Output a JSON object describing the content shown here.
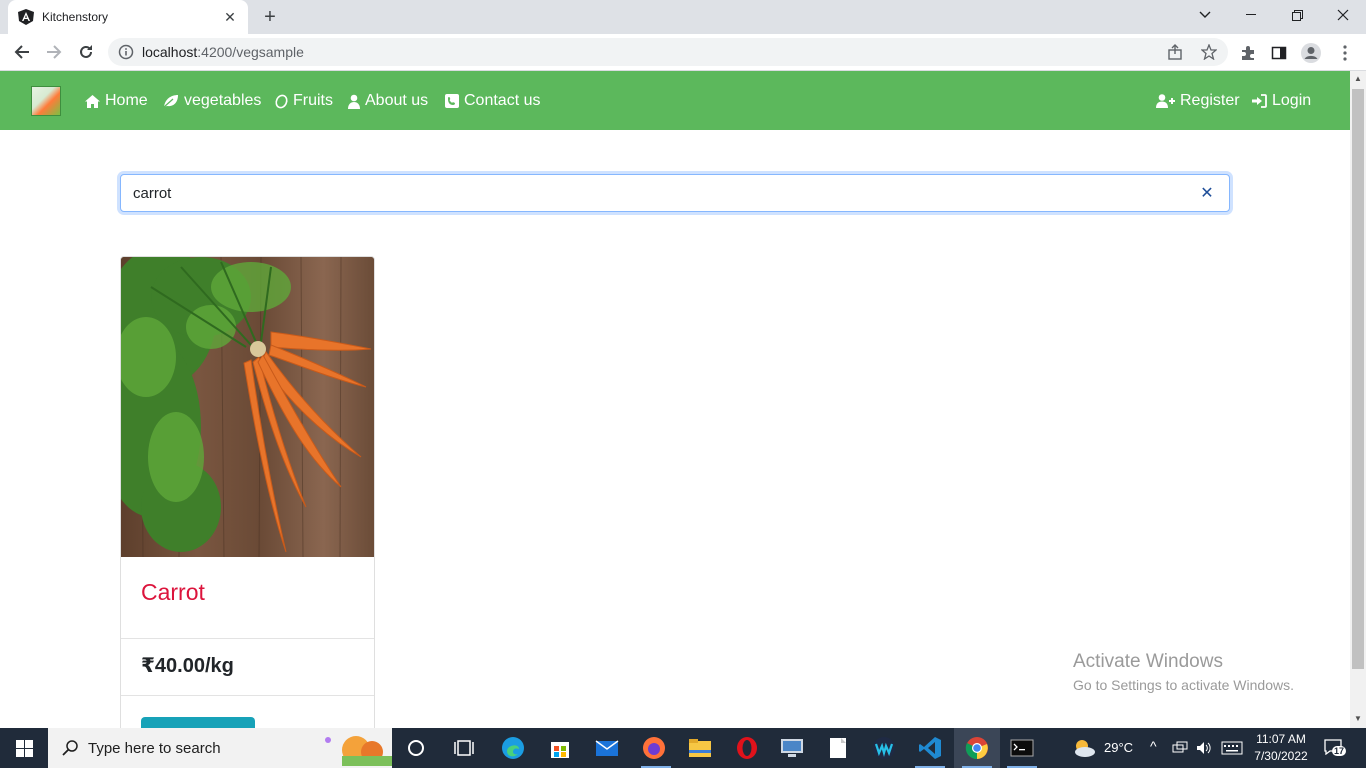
{
  "browser": {
    "tab_title": "Kitchenstory",
    "url_host": "localhost",
    "url_path": ":4200/vegsample"
  },
  "navbar": {
    "items": [
      {
        "label": "Home",
        "icon": "home-icon"
      },
      {
        "label": "vegetables",
        "icon": "leaf-icon"
      },
      {
        "label": "Fruits",
        "icon": "lemon-icon"
      },
      {
        "label": "About us",
        "icon": "user-icon"
      },
      {
        "label": "Contact us",
        "icon": "phone-icon"
      }
    ],
    "register_label": "Register",
    "login_label": "Login",
    "color": "#5cb85c"
  },
  "search": {
    "value": "carrot"
  },
  "products": [
    {
      "name": "Carrot",
      "price": "₹40.00/kg",
      "name_color": "#dc143c"
    }
  ],
  "watermark": {
    "title": "Activate Windows",
    "subtitle": "Go to Settings to activate Windows."
  },
  "taskbar": {
    "search_placeholder": "Type here to search",
    "weather": "29°C",
    "time": "11:07 AM",
    "date": "7/30/2022",
    "notifications": "17"
  }
}
